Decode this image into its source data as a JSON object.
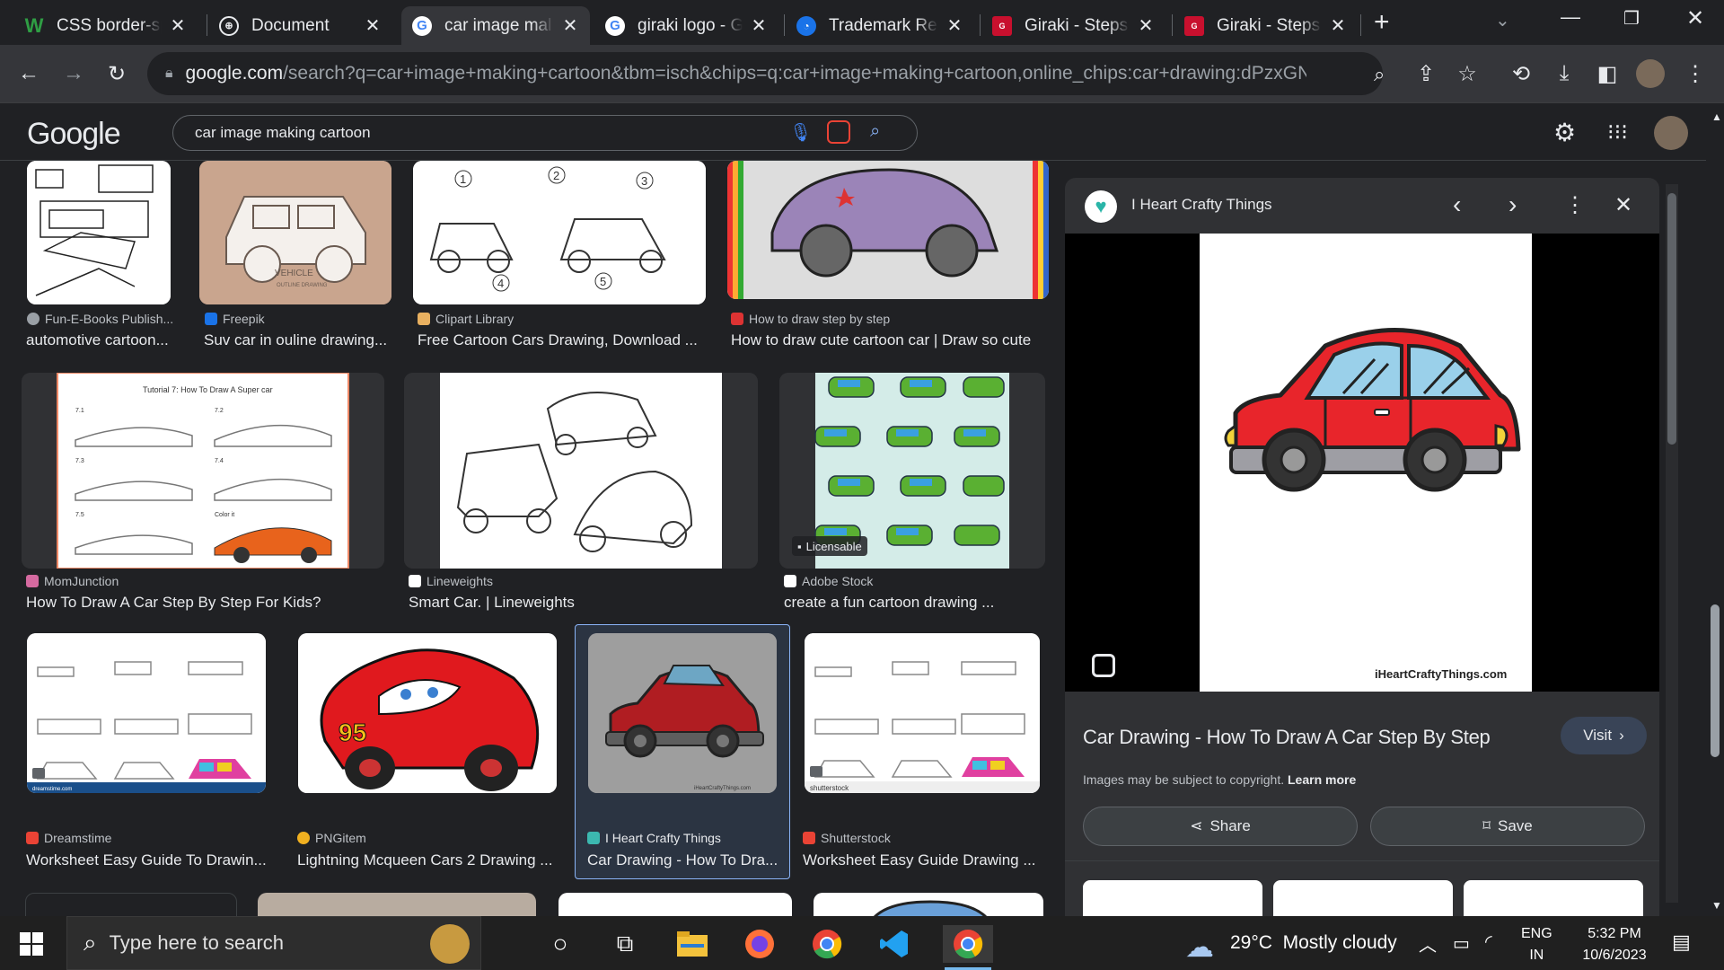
{
  "browser": {
    "tabs": [
      {
        "title": "CSS border-sp",
        "icon": "w-icon"
      },
      {
        "title": "Document",
        "icon": "globe-icon"
      },
      {
        "title": "car image mal",
        "icon": "google-icon",
        "active": true
      },
      {
        "title": "giraki logo - G",
        "icon": "google-icon"
      },
      {
        "title": "Trademark Reg",
        "icon": "trademark-icon"
      },
      {
        "title": "Giraki - Steps",
        "icon": "giraki-icon"
      },
      {
        "title": "Giraki - Steps",
        "icon": "giraki-icon"
      }
    ],
    "url_host": "google.com",
    "url_rest": "/search?q=car+image+making+cartoon&tbm=isch&chips=q:car+image+making+cartoon,online_chips:car+drawing:dPzxGNE..."
  },
  "google": {
    "logo": "Google",
    "query": "car image making cartoon"
  },
  "results": [
    {
      "source": "Fun-E-Books Publish...",
      "caption": "automotive cartoon..."
    },
    {
      "source": "Freepik",
      "caption": "Suv car in ouline drawing..."
    },
    {
      "source": "Clipart Library",
      "caption": "Free Cartoon Cars Drawing, Download ..."
    },
    {
      "source": "How to draw step by step",
      "caption": "How to draw cute cartoon car | Draw so cute"
    },
    {
      "source": "MomJunction",
      "caption": "How To Draw A Car Step By Step For Kids?"
    },
    {
      "source": "Lineweights",
      "caption": "Smart Car. | Lineweights"
    },
    {
      "source": "Adobe Stock",
      "caption": "create a fun cartoon drawing ...",
      "badge": "Licensable"
    },
    {
      "source": "Dreamstime",
      "caption": "Worksheet Easy Guide To Drawin..."
    },
    {
      "source": "PNGitem",
      "caption": "Lightning Mcqueen Cars 2 Drawing ..."
    },
    {
      "source": "I Heart Crafty Things",
      "caption": "Car Drawing - How To Dra..."
    },
    {
      "source": "Shutterstock",
      "caption": "Worksheet Easy Guide Drawing ..."
    }
  ],
  "thumb_texts": {
    "vehicle": "VEHICLE",
    "vehicle_sub": "OUTLINE DRAWING",
    "tutorial": "Tutorial 7: How To Draw A Super car",
    "step_labels": [
      "7.1",
      "7.2",
      "7.3",
      "7.4",
      "7.5",
      "Color it"
    ],
    "numbers": [
      "1",
      "2",
      "3",
      "4",
      "5"
    ],
    "number_95": "95",
    "shutterstock_wm": "shutterstock",
    "dreamstime_wm": "dreamstime.com"
  },
  "panel": {
    "site": "I Heart Crafty Things",
    "watermark": "iHeartCraftyThings.com",
    "title": "Car Drawing - How To Draw A Car Step By Step",
    "visit": "Visit",
    "copyright": "Images may be subject to copyright.",
    "learn_more": "Learn more",
    "share": "Share",
    "save": "Save"
  },
  "taskbar": {
    "search_placeholder": "Type here to search",
    "weather": "29°C  Mostly cloudy",
    "lang1": "ENG",
    "lang2": "IN",
    "time": "5:32 PM",
    "date": "10/6/2023"
  },
  "colors": {
    "bg": "#202124",
    "accent_blue": "#8ab4f8",
    "car_red": "#e8252b"
  }
}
